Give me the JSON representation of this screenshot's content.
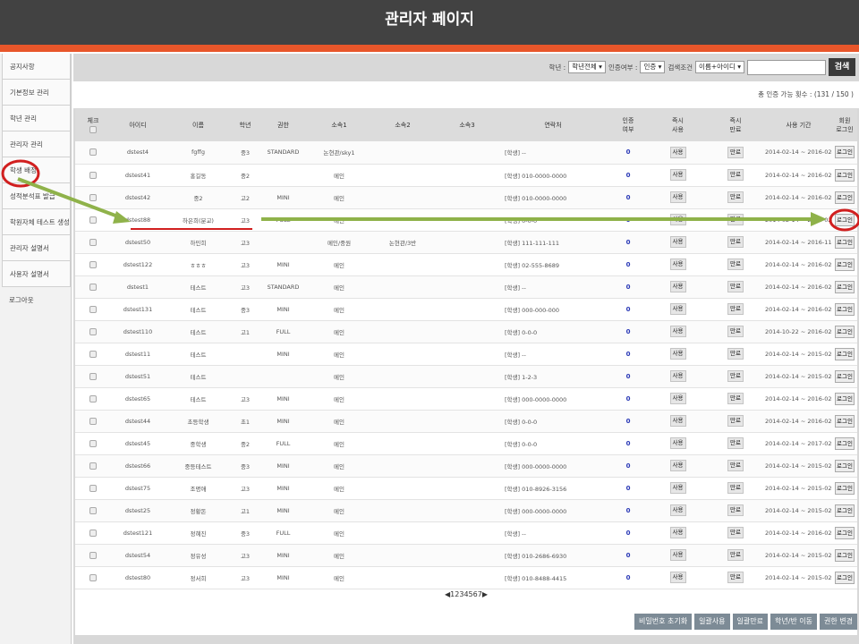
{
  "header": {
    "title": "관리자 페이지"
  },
  "sidebar": {
    "items": [
      {
        "label": "공지사항"
      },
      {
        "label": "기본정보 관리"
      },
      {
        "label": "학년 관리"
      },
      {
        "label": "관리자 관리"
      },
      {
        "label": "학생 배정"
      },
      {
        "label": "성적분석표 발급"
      },
      {
        "label": "학원자체 테스트 생성"
      },
      {
        "label": "관리자 설명서"
      },
      {
        "label": "사용자 설명서"
      },
      {
        "label": "로그아웃"
      }
    ]
  },
  "search": {
    "grade_label": "학년 :",
    "grade_value": "학년전체",
    "auth_label": "인증여부 :",
    "auth_value": "인증",
    "cond_label": "검색조건",
    "cond_value": "이름+아이디",
    "input_placeholder": "",
    "button": "검색"
  },
  "count_text": "총 인증 가능 횟수 : (131 / 150 )",
  "table": {
    "headers": {
      "check": "체크",
      "id": "아이디",
      "name": "이름",
      "grade": "학년",
      "auth": "권한",
      "org1": "소속1",
      "org2": "소속2",
      "org3": "소속3",
      "contact": "연락처",
      "verified_1": "인증",
      "verified_2": "여부",
      "use_1": "즉시",
      "use_2": "사용",
      "end_1": "즉시",
      "end_2": "만료",
      "period": "사용 기간",
      "member_1": "회원",
      "member_2": "로그인"
    },
    "use_btn": "사용",
    "end_btn": "만료",
    "login_btn": "로그인",
    "rows": [
      {
        "id": "dstest4",
        "name": "fgffg",
        "grade": "중3",
        "auth": "STANDARD",
        "org1": "논현관/sky1",
        "org2": "",
        "org3": "",
        "contact": "[학생] --",
        "verified": "0",
        "period": "2014-02-14 ~ 2016-02-29"
      },
      {
        "id": "dstest41",
        "name": "홍길동",
        "grade": "중2",
        "auth": "",
        "org1": "메인",
        "org2": "",
        "org3": "",
        "contact": "[학생] 010-0000-0000",
        "verified": "0",
        "period": "2014-02-14 ~ 2016-02-29"
      },
      {
        "id": "dstest42",
        "name": "중2",
        "grade": "고2",
        "auth": "MINI",
        "org1": "메인",
        "org2": "",
        "org3": "",
        "contact": "[학생] 010-0000-0000",
        "verified": "0",
        "period": "2014-02-14 ~ 2016-02-29"
      },
      {
        "id": "dstest88",
        "name": "하은희(분교)",
        "grade": "고3",
        "auth": "FULL",
        "org1": "메인",
        "org2": "",
        "org3": "",
        "contact": "[학생] 0-0-0",
        "verified": "0",
        "period": "2014-02-14 ~ 2016-02-29"
      },
      {
        "id": "dstest50",
        "name": "하민희",
        "grade": "고3",
        "auth": "",
        "org1": "메인/중원",
        "org2": "논현관/3반",
        "org3": "",
        "contact": "[학생] 111-111-111",
        "verified": "0",
        "period": "2014-02-14 ~ 2016-11-26"
      },
      {
        "id": "dstest122",
        "name": "ㅎㅎㅎ",
        "grade": "고3",
        "auth": "MINI",
        "org1": "메인",
        "org2": "",
        "org3": "",
        "contact": "[학생] 02-555-8689",
        "verified": "0",
        "period": "2014-02-14 ~ 2016-02-29"
      },
      {
        "id": "dstest1",
        "name": "테스트",
        "grade": "고3",
        "auth": "STANDARD",
        "org1": "메인",
        "org2": "",
        "org3": "",
        "contact": "[학생] --",
        "verified": "0",
        "period": "2014-02-14 ~ 2016-02-29"
      },
      {
        "id": "dstest131",
        "name": "테스트",
        "grade": "중3",
        "auth": "MINI",
        "org1": "메인",
        "org2": "",
        "org3": "",
        "contact": "[학생] 000-000-000",
        "verified": "0",
        "period": "2014-02-14 ~ 2016-02-29"
      },
      {
        "id": "dstest110",
        "name": "테스트",
        "grade": "고1",
        "auth": "FULL",
        "org1": "메인",
        "org2": "",
        "org3": "",
        "contact": "[학생] 0-0-0",
        "verified": "0",
        "period": "2014-10-22 ~ 2016-02-29"
      },
      {
        "id": "dstest11",
        "name": "테스트",
        "grade": "",
        "auth": "MINI",
        "org1": "메인",
        "org2": "",
        "org3": "",
        "contact": "[학생] --",
        "verified": "0",
        "period": "2014-02-14 ~ 2015-02-14"
      },
      {
        "id": "dstest51",
        "name": "테스트",
        "grade": "",
        "auth": "",
        "org1": "메인",
        "org2": "",
        "org3": "",
        "contact": "[학생] 1-2-3",
        "verified": "0",
        "period": "2014-02-14 ~ 2015-02-14"
      },
      {
        "id": "dstest65",
        "name": "테스트",
        "grade": "고3",
        "auth": "MINI",
        "org1": "메인",
        "org2": "",
        "org3": "",
        "contact": "[학생] 000-0000-0000",
        "verified": "0",
        "period": "2014-02-14 ~ 2016-02-29"
      },
      {
        "id": "dstest44",
        "name": "초등학생",
        "grade": "초1",
        "auth": "MINI",
        "org1": "메인",
        "org2": "",
        "org3": "",
        "contact": "[학생] 0-0-0",
        "verified": "0",
        "period": "2014-02-14 ~ 2016-02-14"
      },
      {
        "id": "dstest45",
        "name": "중학생",
        "grade": "중2",
        "auth": "FULL",
        "org1": "메인",
        "org2": "",
        "org3": "",
        "contact": "[학생] 0-0-0",
        "verified": "0",
        "period": "2014-02-14 ~ 2017-02-13"
      },
      {
        "id": "dstest66",
        "name": "중등테스트",
        "grade": "중3",
        "auth": "MINI",
        "org1": "메인",
        "org2": "",
        "org3": "",
        "contact": "[학생] 000-0000-0000",
        "verified": "0",
        "period": "2014-02-14 ~ 2015-02-14"
      },
      {
        "id": "dstest75",
        "name": "조명애",
        "grade": "고3",
        "auth": "MINI",
        "org1": "메인",
        "org2": "",
        "org3": "",
        "contact": "[학생] 010-8926-3156",
        "verified": "0",
        "period": "2014-02-14 ~ 2015-02-14"
      },
      {
        "id": "dstest25",
        "name": "정황돈",
        "grade": "고1",
        "auth": "MINI",
        "org1": "메인",
        "org2": "",
        "org3": "",
        "contact": "[학생] 000-0000-0000",
        "verified": "0",
        "period": "2014-02-14 ~ 2015-02-14"
      },
      {
        "id": "dstest121",
        "name": "정혜진",
        "grade": "중3",
        "auth": "FULL",
        "org1": "메인",
        "org2": "",
        "org3": "",
        "contact": "[학생] --",
        "verified": "0",
        "period": "2014-02-14 ~ 2016-02-29"
      },
      {
        "id": "dstest54",
        "name": "정유성",
        "grade": "고3",
        "auth": "MINI",
        "org1": "메인",
        "org2": "",
        "org3": "",
        "contact": "[학생] 010-2686-6930",
        "verified": "0",
        "period": "2014-02-14 ~ 2015-02-14"
      },
      {
        "id": "dstest80",
        "name": "정서희",
        "grade": "고3",
        "auth": "MINI",
        "org1": "메인",
        "org2": "",
        "org3": "",
        "contact": "[학생] 010-8488-4415",
        "verified": "0",
        "period": "2014-02-14 ~ 2015-02-14"
      }
    ]
  },
  "pager": {
    "prev": "◀",
    "pages": [
      "1",
      "2",
      "3",
      "4",
      "5",
      "6",
      "7"
    ],
    "next": "▶"
  },
  "bottom_buttons": [
    {
      "label": "비밀번호 초기화"
    },
    {
      "label": "일괄사용"
    },
    {
      "label": "일괄만료"
    },
    {
      "label": "학년/반 이동"
    },
    {
      "label": "권한 변경"
    }
  ],
  "annotation_colors": {
    "arrow": "#8fb24a",
    "circle": "#d11f1f"
  }
}
